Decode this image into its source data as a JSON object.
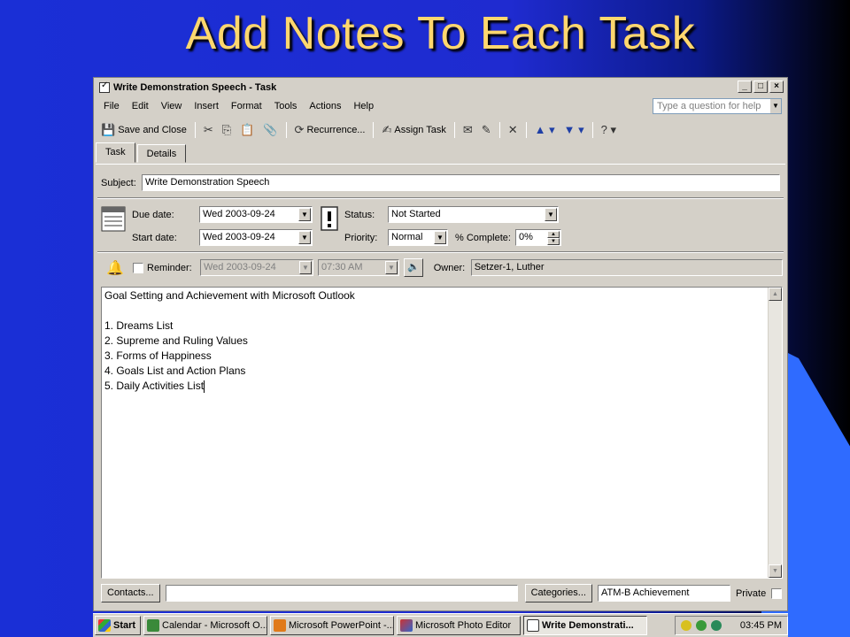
{
  "slide": {
    "title": "Add Notes To Each Task"
  },
  "window": {
    "title": "Write Demonstration Speech - Task",
    "controls": [
      "_",
      "□",
      "×"
    ],
    "menu": [
      "File",
      "Edit",
      "View",
      "Insert",
      "Format",
      "Tools",
      "Actions",
      "Help"
    ],
    "help_placeholder": "Type a question for help",
    "toolbar": {
      "save_close": "Save and Close",
      "recurrence": "Recurrence...",
      "assign_task": "Assign Task"
    },
    "tabs": [
      "Task",
      "Details"
    ],
    "form": {
      "subject_label": "Subject:",
      "subject_value": "Write Demonstration Speech",
      "due_date_label": "Due date:",
      "due_date_value": "Wed 2003-09-24",
      "start_date_label": "Start date:",
      "start_date_value": "Wed 2003-09-24",
      "status_label": "Status:",
      "status_value": "Not Started",
      "priority_label": "Priority:",
      "priority_value": "Normal",
      "percent_label": "% Complete:",
      "percent_value": "0%",
      "reminder_label": "Reminder:",
      "reminder_date": "Wed 2003-09-24",
      "reminder_time": "07:30 AM",
      "owner_label": "Owner:",
      "owner_value": "Setzer-1, Luther"
    },
    "notes": [
      "Goal Setting and Achievement with Microsoft Outlook",
      "",
      "1. Dreams List",
      "2. Supreme and Ruling Values",
      "3. Forms of Happiness",
      "4. Goals List and Action Plans",
      "5. Daily Activities List"
    ],
    "footer": {
      "contacts_button": "Contacts...",
      "categories_button": "Categories...",
      "categories_value": "ATM-B Achievement",
      "private_label": "Private"
    }
  },
  "taskbar": {
    "start": "Start",
    "items": [
      "Calendar - Microsoft O...",
      "Microsoft PowerPoint -...",
      "Microsoft Photo Editor",
      "Write Demonstrati..."
    ],
    "clock": "03:45 PM"
  }
}
